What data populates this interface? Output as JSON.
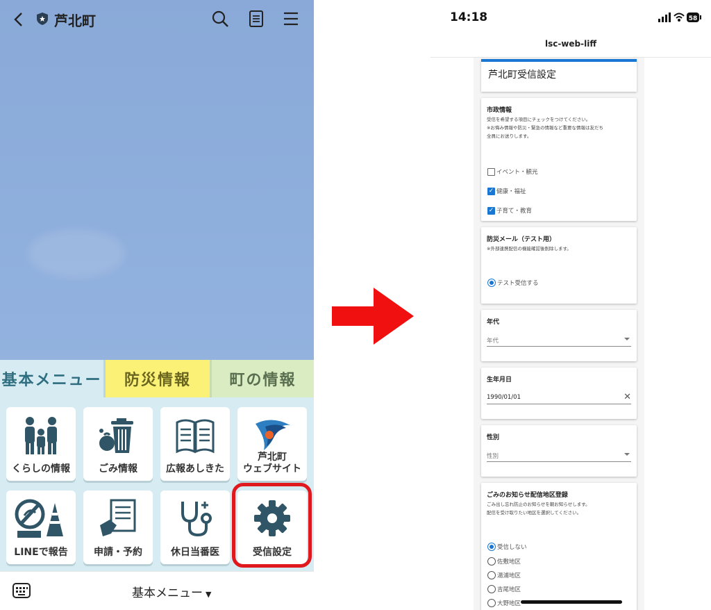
{
  "left": {
    "header": {
      "title": "芦北町"
    },
    "tabs": [
      "基本メニュー",
      "防災情報",
      "町の情報"
    ],
    "buttons": [
      {
        "label": "くらしの情報",
        "icon": "family-icon"
      },
      {
        "label": "ごみ情報",
        "icon": "trash-icon"
      },
      {
        "label": "広報あしきた",
        "icon": "book-icon"
      },
      {
        "label": "芦北町\nウェブサイト",
        "icon": "town-logo-icon"
      },
      {
        "label": "LINEで報告",
        "icon": "report-icon"
      },
      {
        "label": "申請・予約",
        "icon": "application-icon"
      },
      {
        "label": "休日当番医",
        "icon": "stethoscope-icon"
      },
      {
        "label": "受信設定",
        "icon": "gear-icon"
      }
    ],
    "bottom_menu": "基本メニュー",
    "colors": {
      "chat_bg": "#8eaedc",
      "highlight": "#e0191f",
      "icon": "#2f5566"
    }
  },
  "right": {
    "status": {
      "time": "14:18",
      "battery": "58"
    },
    "nav_title": "lsc-web-liff",
    "page_title": "芦北町受信設定",
    "sections": {
      "city": {
        "title": "市政情報",
        "desc": "受信を希望する項目にチェックをつけてください。\n※お悔み情報や防災・緊急の情報など重要な情報は友だち\n全員にお送りします。",
        "options": [
          {
            "label": "イベント・観光",
            "checked": false
          },
          {
            "label": "健康・福祉",
            "checked": true
          },
          {
            "label": "子育て・教育",
            "checked": true
          }
        ]
      },
      "disaster": {
        "title": "防災メール（テスト用）",
        "desc": "※外部連携配信の機能確認後削除します。",
        "option": "テスト受信する"
      },
      "age": {
        "title": "年代",
        "placeholder": "年代"
      },
      "birth": {
        "title": "生年月日",
        "value": "1990/01/01"
      },
      "gender": {
        "title": "性別",
        "placeholder": "性別"
      },
      "garbage": {
        "title": "ごみのお知らせ配信地区登録",
        "desc": "ごみ出し忘れ防止のお知らせを朝お知らせします。\n配信を受け取りたい地区を選択してください。",
        "options": [
          "受信しない",
          "佐敷地区",
          "湯浦地区",
          "吉尾地区",
          "大野地区"
        ],
        "selected": 0
      }
    },
    "colors": {
      "accent": "#1976d2"
    }
  }
}
